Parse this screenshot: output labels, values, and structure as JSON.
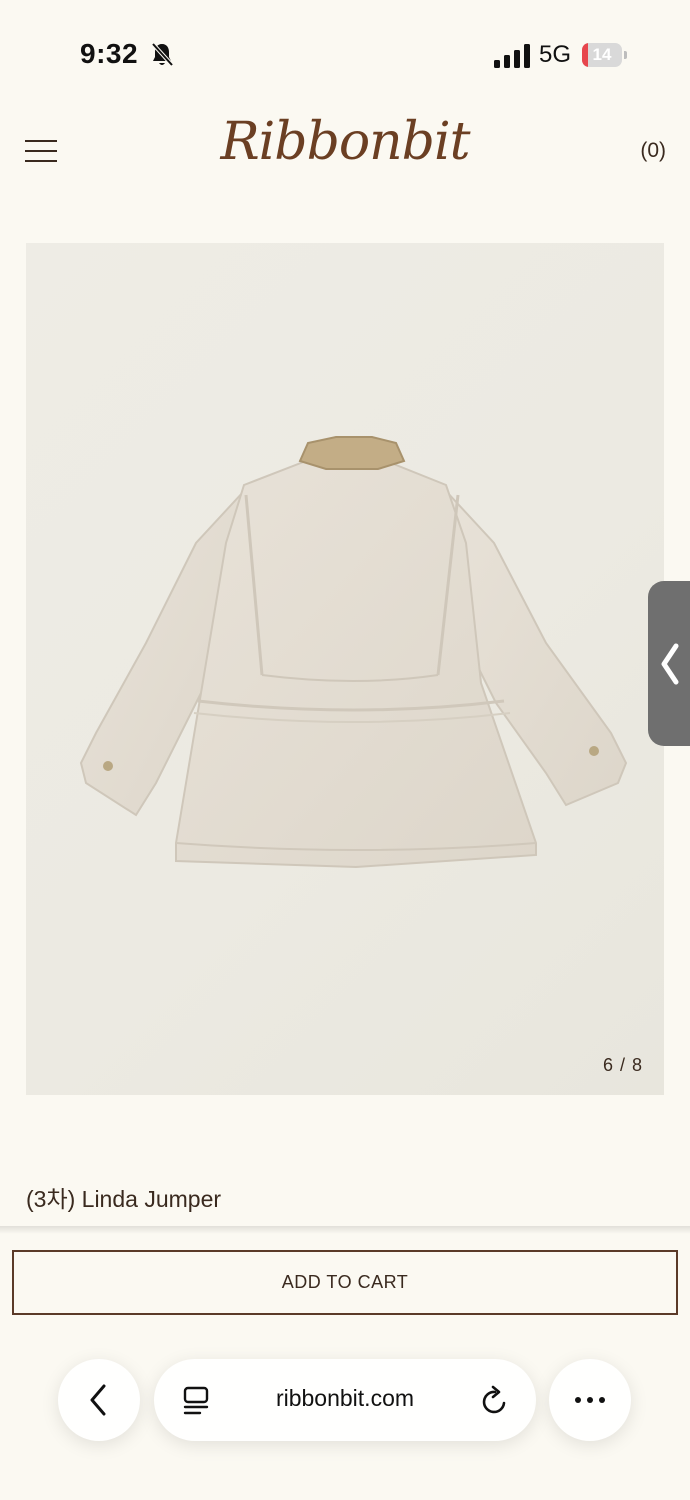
{
  "status_bar": {
    "time": "9:32",
    "network": "5G",
    "battery": "14",
    "battery_level_percent": 14,
    "icons": [
      "bell-slash-icon",
      "signal-icon",
      "battery-icon"
    ]
  },
  "header": {
    "logo": "Ribbonbit",
    "cart_count": "(0)",
    "icons": [
      "menu-icon"
    ]
  },
  "gallery": {
    "counter": "6 / 8",
    "current": 6,
    "total": 8,
    "image": "beige-jacket-back-view"
  },
  "product": {
    "title": "(3차) Linda Jumper"
  },
  "actions": {
    "add_to_cart": "ADD TO CART"
  },
  "browser": {
    "url": "ribbonbit.com",
    "icons": [
      "back-icon",
      "reader-icon",
      "reload-icon",
      "more-icon"
    ]
  },
  "side_tab": {
    "icon": "chevron-left-icon"
  },
  "colors": {
    "background": "#fbf9f2",
    "brand": "#6b3f23",
    "text": "#3a2a1f",
    "button_border": "#5b3a28",
    "side_tab": "#6f6f6f"
  }
}
